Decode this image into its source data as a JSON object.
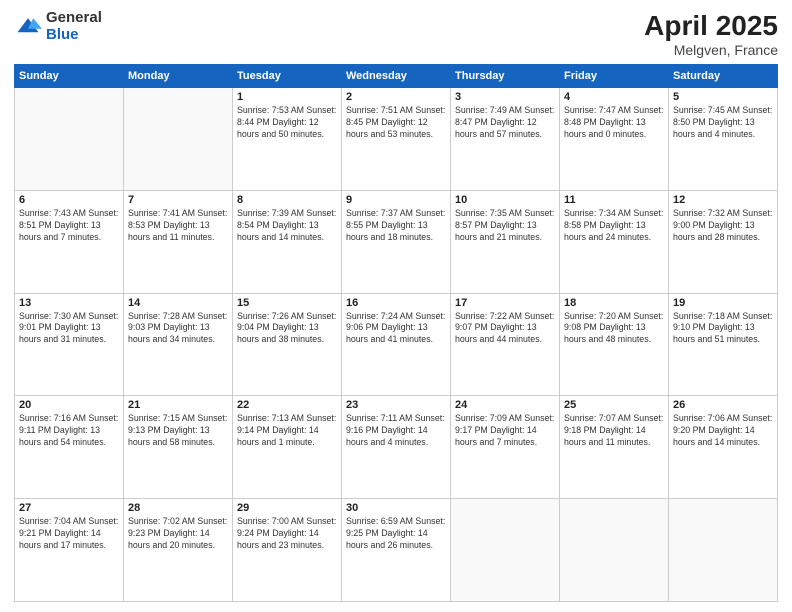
{
  "header": {
    "logo_general": "General",
    "logo_blue": "Blue",
    "main_title": "April 2025",
    "subtitle": "Melgven, France"
  },
  "calendar": {
    "days_of_week": [
      "Sunday",
      "Monday",
      "Tuesday",
      "Wednesday",
      "Thursday",
      "Friday",
      "Saturday"
    ],
    "weeks": [
      [
        {
          "day": "",
          "detail": ""
        },
        {
          "day": "",
          "detail": ""
        },
        {
          "day": "1",
          "detail": "Sunrise: 7:53 AM\nSunset: 8:44 PM\nDaylight: 12 hours and 50 minutes."
        },
        {
          "day": "2",
          "detail": "Sunrise: 7:51 AM\nSunset: 8:45 PM\nDaylight: 12 hours and 53 minutes."
        },
        {
          "day": "3",
          "detail": "Sunrise: 7:49 AM\nSunset: 8:47 PM\nDaylight: 12 hours and 57 minutes."
        },
        {
          "day": "4",
          "detail": "Sunrise: 7:47 AM\nSunset: 8:48 PM\nDaylight: 13 hours and 0 minutes."
        },
        {
          "day": "5",
          "detail": "Sunrise: 7:45 AM\nSunset: 8:50 PM\nDaylight: 13 hours and 4 minutes."
        }
      ],
      [
        {
          "day": "6",
          "detail": "Sunrise: 7:43 AM\nSunset: 8:51 PM\nDaylight: 13 hours and 7 minutes."
        },
        {
          "day": "7",
          "detail": "Sunrise: 7:41 AM\nSunset: 8:53 PM\nDaylight: 13 hours and 11 minutes."
        },
        {
          "day": "8",
          "detail": "Sunrise: 7:39 AM\nSunset: 8:54 PM\nDaylight: 13 hours and 14 minutes."
        },
        {
          "day": "9",
          "detail": "Sunrise: 7:37 AM\nSunset: 8:55 PM\nDaylight: 13 hours and 18 minutes."
        },
        {
          "day": "10",
          "detail": "Sunrise: 7:35 AM\nSunset: 8:57 PM\nDaylight: 13 hours and 21 minutes."
        },
        {
          "day": "11",
          "detail": "Sunrise: 7:34 AM\nSunset: 8:58 PM\nDaylight: 13 hours and 24 minutes."
        },
        {
          "day": "12",
          "detail": "Sunrise: 7:32 AM\nSunset: 9:00 PM\nDaylight: 13 hours and 28 minutes."
        }
      ],
      [
        {
          "day": "13",
          "detail": "Sunrise: 7:30 AM\nSunset: 9:01 PM\nDaylight: 13 hours and 31 minutes."
        },
        {
          "day": "14",
          "detail": "Sunrise: 7:28 AM\nSunset: 9:03 PM\nDaylight: 13 hours and 34 minutes."
        },
        {
          "day": "15",
          "detail": "Sunrise: 7:26 AM\nSunset: 9:04 PM\nDaylight: 13 hours and 38 minutes."
        },
        {
          "day": "16",
          "detail": "Sunrise: 7:24 AM\nSunset: 9:06 PM\nDaylight: 13 hours and 41 minutes."
        },
        {
          "day": "17",
          "detail": "Sunrise: 7:22 AM\nSunset: 9:07 PM\nDaylight: 13 hours and 44 minutes."
        },
        {
          "day": "18",
          "detail": "Sunrise: 7:20 AM\nSunset: 9:08 PM\nDaylight: 13 hours and 48 minutes."
        },
        {
          "day": "19",
          "detail": "Sunrise: 7:18 AM\nSunset: 9:10 PM\nDaylight: 13 hours and 51 minutes."
        }
      ],
      [
        {
          "day": "20",
          "detail": "Sunrise: 7:16 AM\nSunset: 9:11 PM\nDaylight: 13 hours and 54 minutes."
        },
        {
          "day": "21",
          "detail": "Sunrise: 7:15 AM\nSunset: 9:13 PM\nDaylight: 13 hours and 58 minutes."
        },
        {
          "day": "22",
          "detail": "Sunrise: 7:13 AM\nSunset: 9:14 PM\nDaylight: 14 hours and 1 minute."
        },
        {
          "day": "23",
          "detail": "Sunrise: 7:11 AM\nSunset: 9:16 PM\nDaylight: 14 hours and 4 minutes."
        },
        {
          "day": "24",
          "detail": "Sunrise: 7:09 AM\nSunset: 9:17 PM\nDaylight: 14 hours and 7 minutes."
        },
        {
          "day": "25",
          "detail": "Sunrise: 7:07 AM\nSunset: 9:18 PM\nDaylight: 14 hours and 11 minutes."
        },
        {
          "day": "26",
          "detail": "Sunrise: 7:06 AM\nSunset: 9:20 PM\nDaylight: 14 hours and 14 minutes."
        }
      ],
      [
        {
          "day": "27",
          "detail": "Sunrise: 7:04 AM\nSunset: 9:21 PM\nDaylight: 14 hours and 17 minutes."
        },
        {
          "day": "28",
          "detail": "Sunrise: 7:02 AM\nSunset: 9:23 PM\nDaylight: 14 hours and 20 minutes."
        },
        {
          "day": "29",
          "detail": "Sunrise: 7:00 AM\nSunset: 9:24 PM\nDaylight: 14 hours and 23 minutes."
        },
        {
          "day": "30",
          "detail": "Sunrise: 6:59 AM\nSunset: 9:25 PM\nDaylight: 14 hours and 26 minutes."
        },
        {
          "day": "",
          "detail": ""
        },
        {
          "day": "",
          "detail": ""
        },
        {
          "day": "",
          "detail": ""
        }
      ]
    ]
  }
}
